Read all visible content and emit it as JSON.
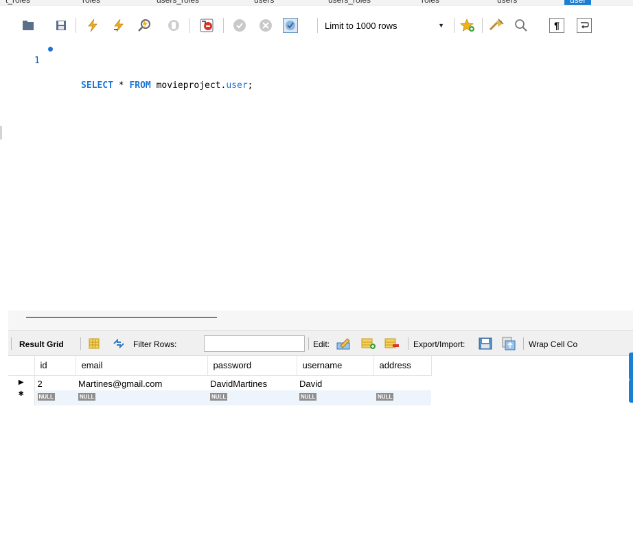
{
  "tabs": [
    {
      "label": "t_roles"
    },
    {
      "label": "roles"
    },
    {
      "label": "users_roles"
    },
    {
      "label": "users"
    },
    {
      "label": "users_roles"
    },
    {
      "label": "roles"
    },
    {
      "label": "users"
    },
    {
      "label": "user",
      "active": true
    }
  ],
  "toolbar": {
    "icons": [
      "open-folder-icon",
      "save-icon",
      "execute-icon",
      "execute-current-icon",
      "explain-icon",
      "stop-icon",
      "toggle-error-stop-icon",
      "commit-icon",
      "rollback-icon",
      "autocommit-icon",
      "bookmark-icon",
      "beautify-icon",
      "find-icon",
      "invisible-chars-icon",
      "wrap-icon"
    ],
    "limit_label": "Limit to 1000 rows"
  },
  "editor": {
    "line_number": "1",
    "kw_select": "SELECT",
    "star": " * ",
    "kw_from": "FROM",
    "schema": " movieproject.",
    "table": "user",
    "semicolon": ";"
  },
  "result_toolbar": {
    "result_grid": "Result Grid",
    "filter_rows": "Filter Rows:",
    "filter_value": "",
    "edit": "Edit:",
    "export_import": "Export/Import:",
    "wrap_cell": "Wrap Cell Co"
  },
  "grid": {
    "columns": [
      "id",
      "email",
      "password",
      "username",
      "address"
    ],
    "rows": [
      {
        "id": "2",
        "email": "Martines@gmail.com",
        "password": "DavidMartines",
        "username": "David",
        "address": ""
      }
    ],
    "null_label": "NULL"
  },
  "colors": {
    "accent": "#1a7fd4",
    "keyword": "#1a73d6"
  }
}
